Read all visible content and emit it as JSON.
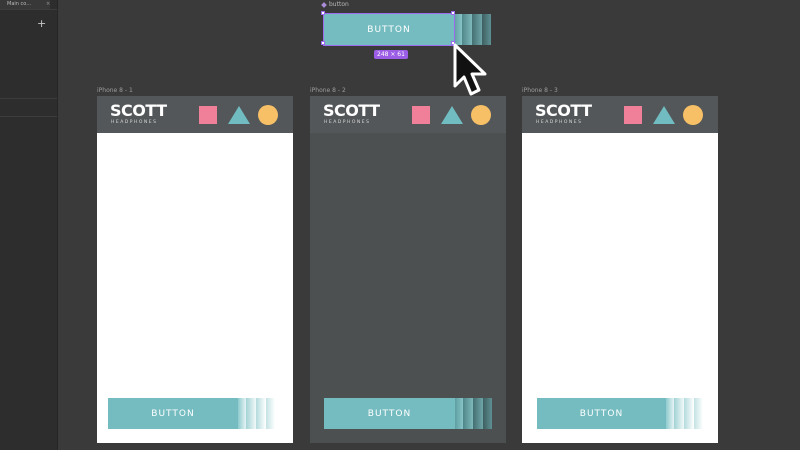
{
  "sidebar": {
    "tab_label": "Main co...",
    "tab_close": "×",
    "add_icon": "+"
  },
  "component": {
    "label": "button",
    "button_label": "BUTTON",
    "size_tag": "248 × 61",
    "icon": "diamond-component-icon"
  },
  "frames": [
    {
      "label": "iPhone 8 - 1",
      "logo": "SCOTT",
      "logo_sub": "HEADPHONES",
      "button_label": "BUTTON",
      "body_color": "#ffffff"
    },
    {
      "label": "iPhone 8 - 2",
      "logo": "SCOTT",
      "logo_sub": "HEADPHONES",
      "button_label": "BUTTON",
      "body_color": "#4c5051"
    },
    {
      "label": "iPhone 8 - 3",
      "logo": "SCOTT",
      "logo_sub": "HEADPHONES",
      "button_label": "BUTTON",
      "body_color": "#ffffff"
    }
  ],
  "colors": {
    "accent_teal": "#75bcc0",
    "pink": "#f07f9a",
    "yellow": "#f7c066",
    "selection": "#9b6cf0",
    "header_gray": "#535759"
  }
}
